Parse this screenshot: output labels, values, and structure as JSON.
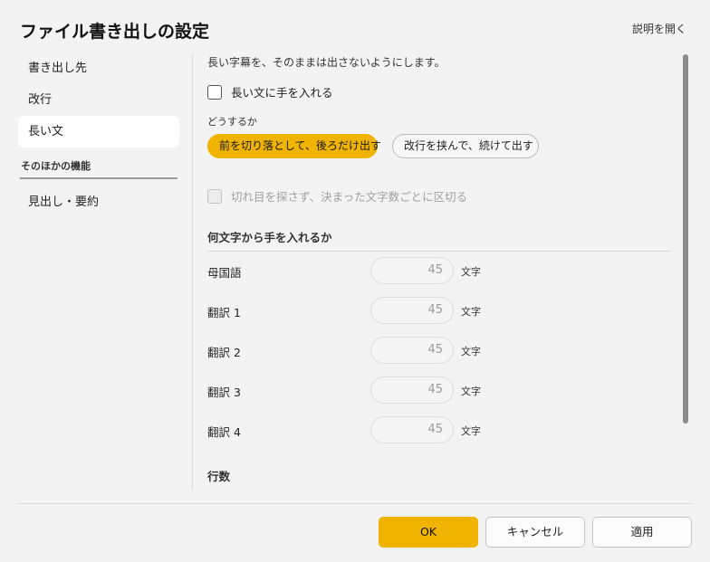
{
  "dialog": {
    "title": "ファイル書き出しの設定",
    "help_link": "説明を開く"
  },
  "sidebar": {
    "items": [
      {
        "label": "書き出し先"
      },
      {
        "label": "改行"
      },
      {
        "label": "長い文",
        "active": true
      }
    ],
    "group_label": "そのほかの機能",
    "group_items": [
      {
        "label": "見出し・要約"
      }
    ]
  },
  "content": {
    "description": "長い字幕を、そのままは出さないようにします。",
    "enable_checkbox": {
      "label": "長い文に手を入れる",
      "checked": false
    },
    "mode_label": "どうするか",
    "mode_options": [
      {
        "label": "前を切り落として、後ろだけ出す",
        "selected": true
      },
      {
        "label": "改行を挟んで、続けて出す",
        "selected": false
      }
    ],
    "fixed_split_checkbox": {
      "label": "切れ目を探さず、決まった文字数ごとに区切る",
      "checked": false,
      "disabled": true
    },
    "threshold_section": {
      "title": "何文字から手を入れるか",
      "unit": "文字",
      "rows": [
        {
          "label": "母国語",
          "value": "45"
        },
        {
          "label": "翻訳 1",
          "value": "45"
        },
        {
          "label": "翻訳 2",
          "value": "45"
        },
        {
          "label": "翻訳 3",
          "value": "45"
        },
        {
          "label": "翻訳 4",
          "value": "45"
        }
      ]
    },
    "lines_section": {
      "title": "行数"
    }
  },
  "footer": {
    "ok": "OK",
    "cancel": "キャンセル",
    "apply": "適用"
  },
  "colors": {
    "accent": "#f0b400",
    "background": "#f3f3f3"
  }
}
